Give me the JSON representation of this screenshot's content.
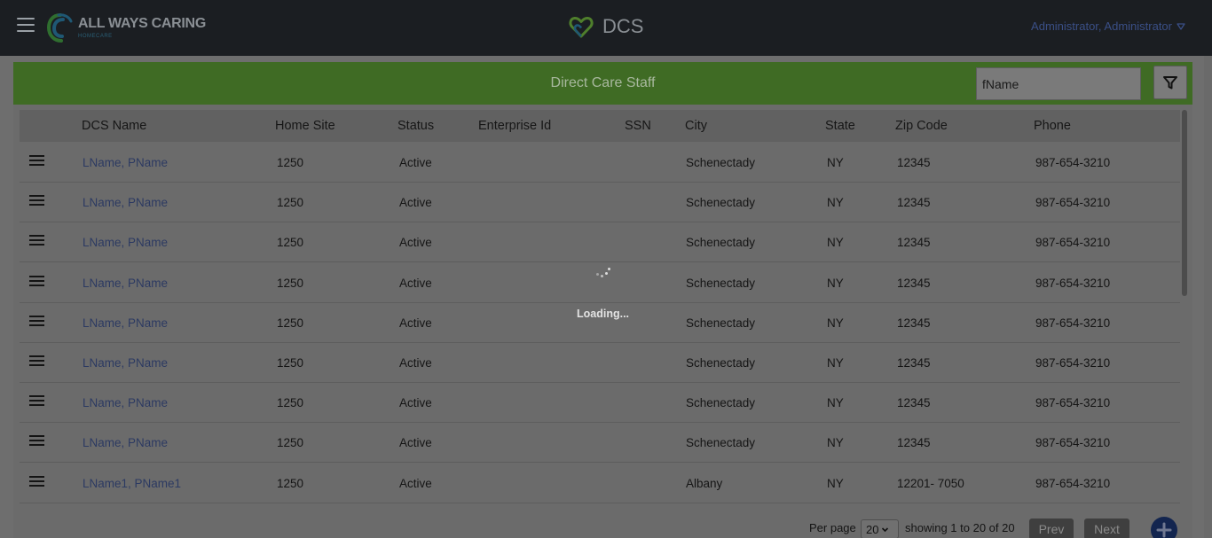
{
  "navbar": {
    "brand_name": "ALL WAYS CARING",
    "brand_sub": "HOMECARE",
    "app_title": "DCS",
    "user_label": "Administrator, Administrator"
  },
  "panel": {
    "title": "Direct Care Staff",
    "search_value": "fName"
  },
  "table": {
    "headers": {
      "name": "DCS Name",
      "home_site": "Home Site",
      "status": "Status",
      "enterprise_id": "Enterprise Id",
      "ssn": "SSN",
      "city": "City",
      "state": "State",
      "zip": "Zip Code",
      "phone": "Phone"
    },
    "rows": [
      {
        "name": "LName, PName",
        "home_site": "1250",
        "status": "Active",
        "enterprise_id": "",
        "ssn": "",
        "city": "Schenectady",
        "state": "NY",
        "zip": "12345",
        "phone": "987-654-3210"
      },
      {
        "name": "LName, PName",
        "home_site": "1250",
        "status": "Active",
        "enterprise_id": "",
        "ssn": "",
        "city": "Schenectady",
        "state": "NY",
        "zip": "12345",
        "phone": "987-654-3210"
      },
      {
        "name": "LName, PName",
        "home_site": "1250",
        "status": "Active",
        "enterprise_id": "",
        "ssn": "",
        "city": "Schenectady",
        "state": "NY",
        "zip": "12345",
        "phone": "987-654-3210"
      },
      {
        "name": "LName, PName",
        "home_site": "1250",
        "status": "Active",
        "enterprise_id": "",
        "ssn": "",
        "city": "Schenectady",
        "state": "NY",
        "zip": "12345",
        "phone": "987-654-3210"
      },
      {
        "name": "LName, PName",
        "home_site": "1250",
        "status": "Active",
        "enterprise_id": "",
        "ssn": "",
        "city": "Schenectady",
        "state": "NY",
        "zip": "12345",
        "phone": "987-654-3210"
      },
      {
        "name": "LName, PName",
        "home_site": "1250",
        "status": "Active",
        "enterprise_id": "",
        "ssn": "",
        "city": "Schenectady",
        "state": "NY",
        "zip": "12345",
        "phone": "987-654-3210"
      },
      {
        "name": "LName, PName",
        "home_site": "1250",
        "status": "Active",
        "enterprise_id": "",
        "ssn": "",
        "city": "Schenectady",
        "state": "NY",
        "zip": "12345",
        "phone": "987-654-3210"
      },
      {
        "name": "LName, PName",
        "home_site": "1250",
        "status": "Active",
        "enterprise_id": "",
        "ssn": "",
        "city": "Schenectady",
        "state": "NY",
        "zip": "12345",
        "phone": "987-654-3210"
      },
      {
        "name": "LName1, PName1",
        "home_site": "1250",
        "status": "Active",
        "enterprise_id": "",
        "ssn": "",
        "city": "Albany",
        "state": "NY",
        "zip": "12201- 7050",
        "phone": "987-654-3210"
      }
    ]
  },
  "loading": {
    "text": "Loading..."
  },
  "pagination": {
    "per_page_label": "Per page",
    "per_page_value": "20",
    "showing": "showing 1 to 20 of 20",
    "prev": "Prev",
    "next": "Next"
  },
  "icons": {
    "menu": "hamburger-menu-icon",
    "logo": "all-ways-caring-logo",
    "heart": "heart-logo-icon",
    "dropdown": "triangle-down-icon",
    "filter": "filter-funnel-icon",
    "row_menu": "row-menu-icon",
    "add": "plus-icon",
    "spinner": "spinner-icon"
  },
  "colors": {
    "navbar_bg": "#1b1e22",
    "panel_header": "#3f6b24",
    "link": "#2c3a62",
    "add_button": "#13254f",
    "overlay": "#6b6b6b"
  }
}
